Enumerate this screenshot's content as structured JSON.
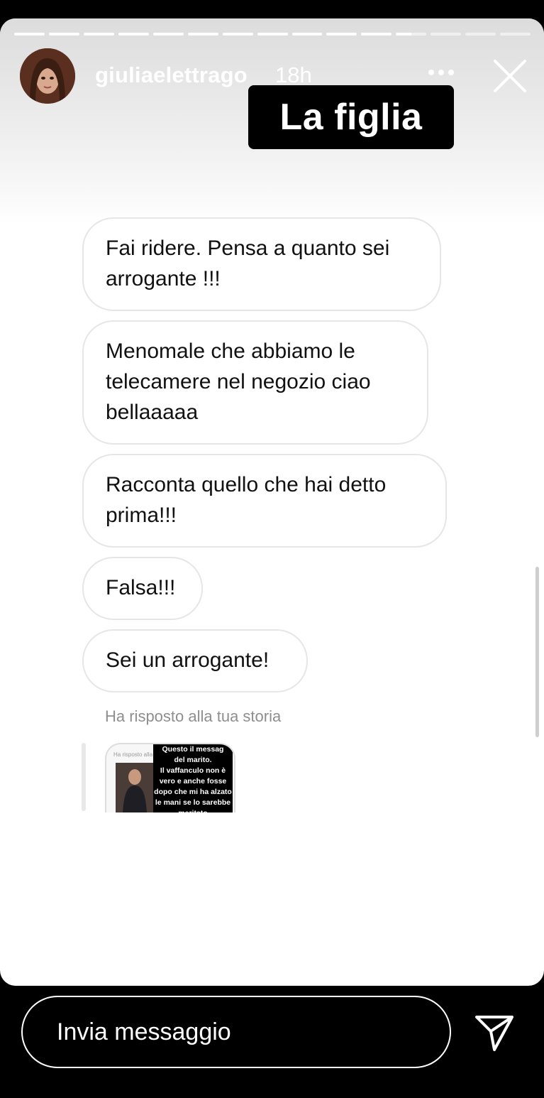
{
  "story": {
    "username": "giuliaelettrago",
    "time": "18h",
    "caption": "La figlia",
    "progress": {
      "segments": 15,
      "completed": 11,
      "current_fraction": 0.5
    }
  },
  "messages": [
    {
      "text": "Fai ridere. Pensa a quanto sei\narrogante !!!"
    },
    {
      "text": "Menomale che abbiamo le\ntelecamere nel negozio ciao\nbellaaaaa"
    },
    {
      "text": "Racconta quello che hai detto\nprima!!!"
    },
    {
      "text": "Falsa!!!"
    },
    {
      "text": "Sei un arrogante!"
    }
  ],
  "reply": {
    "note": "Ha risposto alla tua storia",
    "thumbnail_header": "Ha risposto alla tua storia",
    "thumbnail_caption": "Questo il messag\ndel marito.\nIl vaffanculo non è\nvero e anche fosse\ndopo che mi ha alzato\nle mani se lo sarebbe\nmeritato"
  },
  "composer": {
    "placeholder": "Invia messaggio"
  },
  "icons": {
    "more": "more-dots-icon",
    "close": "close-icon",
    "send": "send-icon"
  },
  "colors": {
    "background": "#000000",
    "bubble_border": "#e6e6e6",
    "meta_text": "#8e8e8e"
  }
}
